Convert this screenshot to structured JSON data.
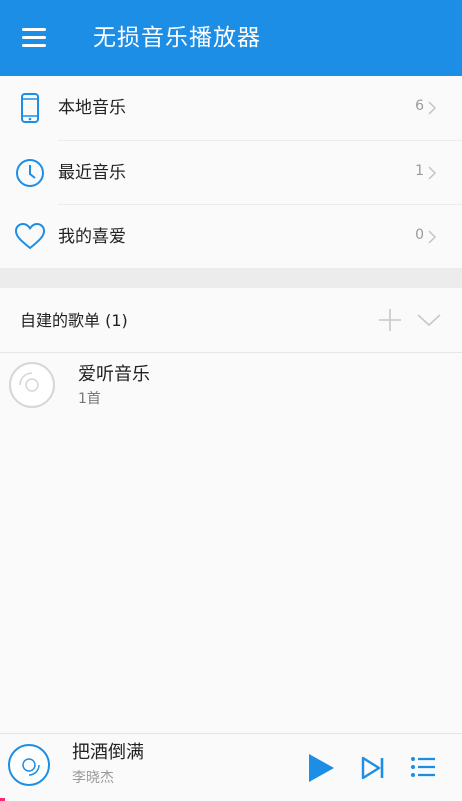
{
  "app": {
    "title": "无损音乐播放器",
    "accent_color": "#1d8ee6"
  },
  "library": {
    "items": [
      {
        "label": "本地音乐",
        "count": "6",
        "icon": "phone-icon"
      },
      {
        "label": "最近音乐",
        "count": "1",
        "icon": "clock-icon"
      },
      {
        "label": "我的喜爱",
        "count": "0",
        "icon": "heart-icon"
      }
    ]
  },
  "playlists": {
    "header": "自建的歌单 (1)",
    "add_icon": "plus-icon",
    "collapse_icon": "chevron-down-icon",
    "items": [
      {
        "name": "爱听音乐",
        "count": "1首",
        "icon": "disc-icon"
      }
    ]
  },
  "player": {
    "song": "把酒倒满",
    "artist": "李晓杰",
    "progress": 0.01,
    "icons": [
      "disc-icon",
      "play-icon",
      "next-icon",
      "queue-icon"
    ]
  }
}
